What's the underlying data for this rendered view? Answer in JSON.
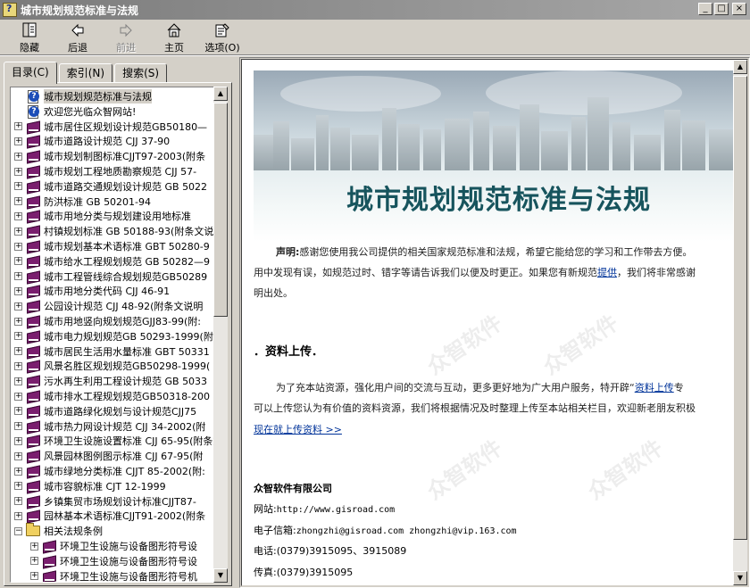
{
  "window": {
    "title": "城市规划规范标准与法规"
  },
  "toolbar": {
    "hide": "隐藏",
    "back": "后退",
    "forward": "前进",
    "home": "主页",
    "options": "选项(O)"
  },
  "tabs": [
    "目录(C)",
    "索引(N)",
    "搜索(S)"
  ],
  "tree": {
    "items": [
      {
        "label": "城市规划规范标准与法规",
        "icon": "help-page-icon",
        "expander": "",
        "indent": 0
      },
      {
        "label": "欢迎您光临众智网站!",
        "icon": "help-page-icon",
        "expander": "",
        "indent": 0
      },
      {
        "label": "城市居住区规划设计规范GB50180—",
        "icon": "book-icon",
        "expander": "+",
        "indent": 0
      },
      {
        "label": "城市道路设计规范 CJJ 37-90",
        "icon": "book-icon",
        "expander": "+",
        "indent": 0
      },
      {
        "label": "城市规划制图标准CJJT97-2003(附条",
        "icon": "book-icon",
        "expander": "+",
        "indent": 0
      },
      {
        "label": "城市规划工程地质勘察规范 CJJ 57-",
        "icon": "book-icon",
        "expander": "+",
        "indent": 0
      },
      {
        "label": "城市道路交通规划设计规范 GB 5022",
        "icon": "book-icon",
        "expander": "+",
        "indent": 0
      },
      {
        "label": "防洪标准 GB 50201-94",
        "icon": "book-icon",
        "expander": "+",
        "indent": 0
      },
      {
        "label": "城市用地分类与规划建设用地标准",
        "icon": "book-icon",
        "expander": "+",
        "indent": 0
      },
      {
        "label": "村镇规划标准 GB 50188-93(附条文说",
        "icon": "book-icon",
        "expander": "+",
        "indent": 0
      },
      {
        "label": "城市规划基本术语标准 GBT 50280-9",
        "icon": "book-icon",
        "expander": "+",
        "indent": 0
      },
      {
        "label": "城市给水工程规划规范 GB 50282—9",
        "icon": "book-icon",
        "expander": "+",
        "indent": 0
      },
      {
        "label": "城市工程管线综合规划规范GB50289",
        "icon": "book-icon",
        "expander": "+",
        "indent": 0
      },
      {
        "label": "城市用地分类代码 CJJ 46-91",
        "icon": "book-icon",
        "expander": "+",
        "indent": 0
      },
      {
        "label": "公园设计规范 CJJ 48-92(附条文说明",
        "icon": "book-icon",
        "expander": "+",
        "indent": 0
      },
      {
        "label": "城市用地竖向规划规范GJJ83-99(附:",
        "icon": "book-icon",
        "expander": "+",
        "indent": 0
      },
      {
        "label": "城市电力规划规范GB 50293-1999(附",
        "icon": "book-icon",
        "expander": "+",
        "indent": 0
      },
      {
        "label": "城市居民生活用水量标准 GBT 50331",
        "icon": "book-icon",
        "expander": "+",
        "indent": 0
      },
      {
        "label": "风景名胜区规划规范GB50298-1999(",
        "icon": "book-icon",
        "expander": "+",
        "indent": 0
      },
      {
        "label": "污水再生利用工程设计规范 GB 5033",
        "icon": "book-icon",
        "expander": "+",
        "indent": 0
      },
      {
        "label": "城市排水工程规划规范GB50318-200",
        "icon": "book-icon",
        "expander": "+",
        "indent": 0
      },
      {
        "label": "城市道路绿化规划与设计规范CJJ75",
        "icon": "book-icon",
        "expander": "+",
        "indent": 0
      },
      {
        "label": "城市热力网设计规范 CJJ 34-2002(附",
        "icon": "book-icon",
        "expander": "+",
        "indent": 0
      },
      {
        "label": "环境卫生设施设置标准 CJJ 65-95(附条文",
        "icon": "book-icon",
        "expander": "+",
        "indent": 0
      },
      {
        "label": "风景园林图例图示标准 CJJ 67-95(附",
        "icon": "book-icon",
        "expander": "+",
        "indent": 0
      },
      {
        "label": "城市绿地分类标准 CJJT 85-2002(附:",
        "icon": "book-icon",
        "expander": "+",
        "indent": 0
      },
      {
        "label": "城市容貌标准 CJT 12-1999",
        "icon": "book-icon",
        "expander": "+",
        "indent": 0
      },
      {
        "label": "乡镇集贸市场规划设计标准CJJT87-",
        "icon": "book-icon",
        "expander": "+",
        "indent": 0
      },
      {
        "label": "园林基本术语标准CJJT91-2002(附条",
        "icon": "book-icon",
        "expander": "+",
        "indent": 0
      },
      {
        "label": "相关法规条例",
        "icon": "folder-icon",
        "expander": "−",
        "indent": 0
      },
      {
        "label": "环境卫生设施与设备图形符号设",
        "icon": "book-icon",
        "expander": "+",
        "indent": 1
      },
      {
        "label": "环境卫生设施与设备图形符号设",
        "icon": "book-icon",
        "expander": "+",
        "indent": 1
      },
      {
        "label": "环境卫生设施与设备图形符号机",
        "icon": "book-icon",
        "expander": "+",
        "indent": 1
      }
    ]
  },
  "content": {
    "banner_title": "城市规划规范标准与法规",
    "statement_label": "声明:",
    "statement_line1": "感谢您使用我公司提供的相关国家规范标准和法规，希望它能给您的学习和工作带去方便。",
    "statement_line2_a": "用中发现有误，如规范过时、错字等请告诉我们以便及时更正。如果您有新规范",
    "statement_link": "提供",
    "statement_line2_b": "，我们将非常感谢",
    "statement_line3": "明出处。",
    "section_title": "．资料上传．",
    "upload_line1_a": "为了充本站资源，强化用户间的交流与互动，更多更好地为广大用户服务，特开辟“",
    "upload_link": "资料上传",
    "upload_line1_b": "专",
    "upload_line2": "可以上传您认为有价值的资料资源，我们将根据情况及时整理上传至本站相关栏目，欢迎新老朋友积极",
    "upload_now_link": "现在就上传资料 >>",
    "company": "众智软件有限公司",
    "website_label": "网站:",
    "website_value": "http://www.gisroad.com",
    "email_label": "电子信箱:",
    "email_value": "zhongzhi@gisroad.com zhongzhi@vip.163.com",
    "phone_label": "电话:",
    "phone_value": "(0379)3915095、3915089",
    "fax_label": "传真:",
    "fax_value": "(0379)3915095",
    "watermark": "众智软件",
    "watermark_url": "http://www.gisroad.com"
  }
}
